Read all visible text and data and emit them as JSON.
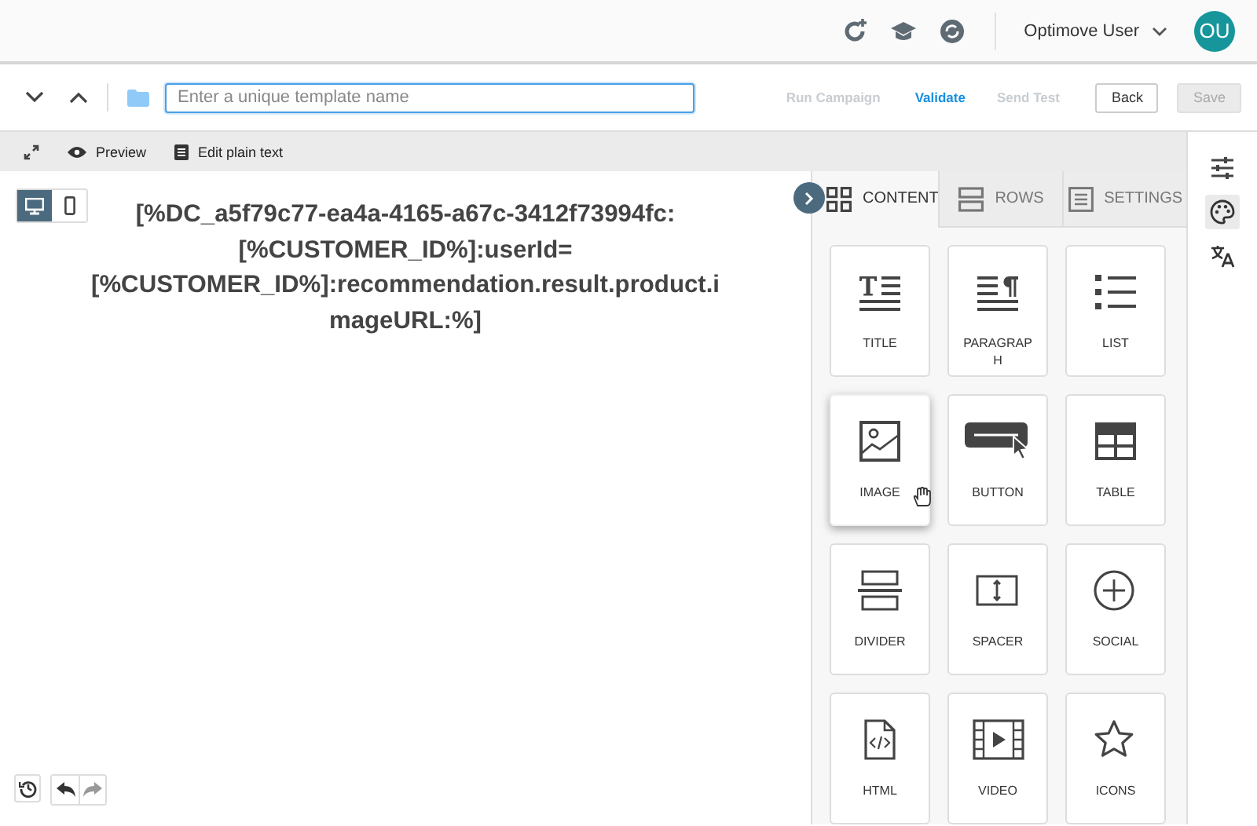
{
  "header": {
    "user_name": "Optimove User",
    "avatar_initials": "OU"
  },
  "toolbar": {
    "template_name": {
      "placeholder": "Enter a unique template name"
    },
    "actions": [
      {
        "label": "Run Campaign",
        "kind": "link",
        "disabled": true
      },
      {
        "label": "Validate",
        "kind": "link",
        "disabled": false
      },
      {
        "label": "Send Test",
        "kind": "link",
        "disabled": true
      },
      {
        "label": "Back",
        "kind": "button",
        "disabled": false
      },
      {
        "label": "Save",
        "kind": "button",
        "disabled": true
      }
    ]
  },
  "subbar": {
    "items": [
      {
        "label": "Preview",
        "kind": "preview"
      },
      {
        "label": "Edit plain text",
        "kind": "plaintext"
      }
    ]
  },
  "canvas": {
    "devices": [
      {
        "kind": "desktop",
        "selected": true
      },
      {
        "kind": "mobile",
        "selected": false
      }
    ],
    "content_lines": [
      "[%DC_a5f79c77-ea4a-4165-a67c-3412f73994fc:",
      "[%CUSTOMER_ID%]:userId=",
      "[%CUSTOMER_ID%]:recommendation.result.product.i",
      "mageURL:%]"
    ]
  },
  "panel": {
    "tabs": [
      {
        "label": "CONTENT",
        "kind": "content",
        "selected": true
      },
      {
        "label": "ROWS",
        "kind": "rows",
        "selected": false
      },
      {
        "label": "SETTINGS",
        "kind": "settings",
        "selected": false
      }
    ],
    "blocks": [
      {
        "label": "TITLE",
        "kind": "title",
        "hovered": false
      },
      {
        "label": "PARAGRAP\nH",
        "kind": "paragraph",
        "hovered": false
      },
      {
        "label": "LIST",
        "kind": "list",
        "hovered": false
      },
      {
        "label": "IMAGE",
        "kind": "image",
        "hovered": true
      },
      {
        "label": "BUTTON",
        "kind": "button",
        "hovered": false
      },
      {
        "label": "TABLE",
        "kind": "table",
        "hovered": false
      },
      {
        "label": "DIVIDER",
        "kind": "divider",
        "hovered": false
      },
      {
        "label": "SPACER",
        "kind": "spacer",
        "hovered": false
      },
      {
        "label": "SOCIAL",
        "kind": "social",
        "hovered": false
      },
      {
        "label": "HTML",
        "kind": "html",
        "hovered": false
      },
      {
        "label": "VIDEO",
        "kind": "video",
        "hovered": false
      },
      {
        "label": "ICONS",
        "kind": "icons",
        "hovered": false
      }
    ]
  },
  "rail": {
    "items": [
      {
        "kind": "sliders",
        "selected": false
      },
      {
        "kind": "palette",
        "selected": true
      },
      {
        "kind": "translate",
        "selected": false
      }
    ]
  }
}
